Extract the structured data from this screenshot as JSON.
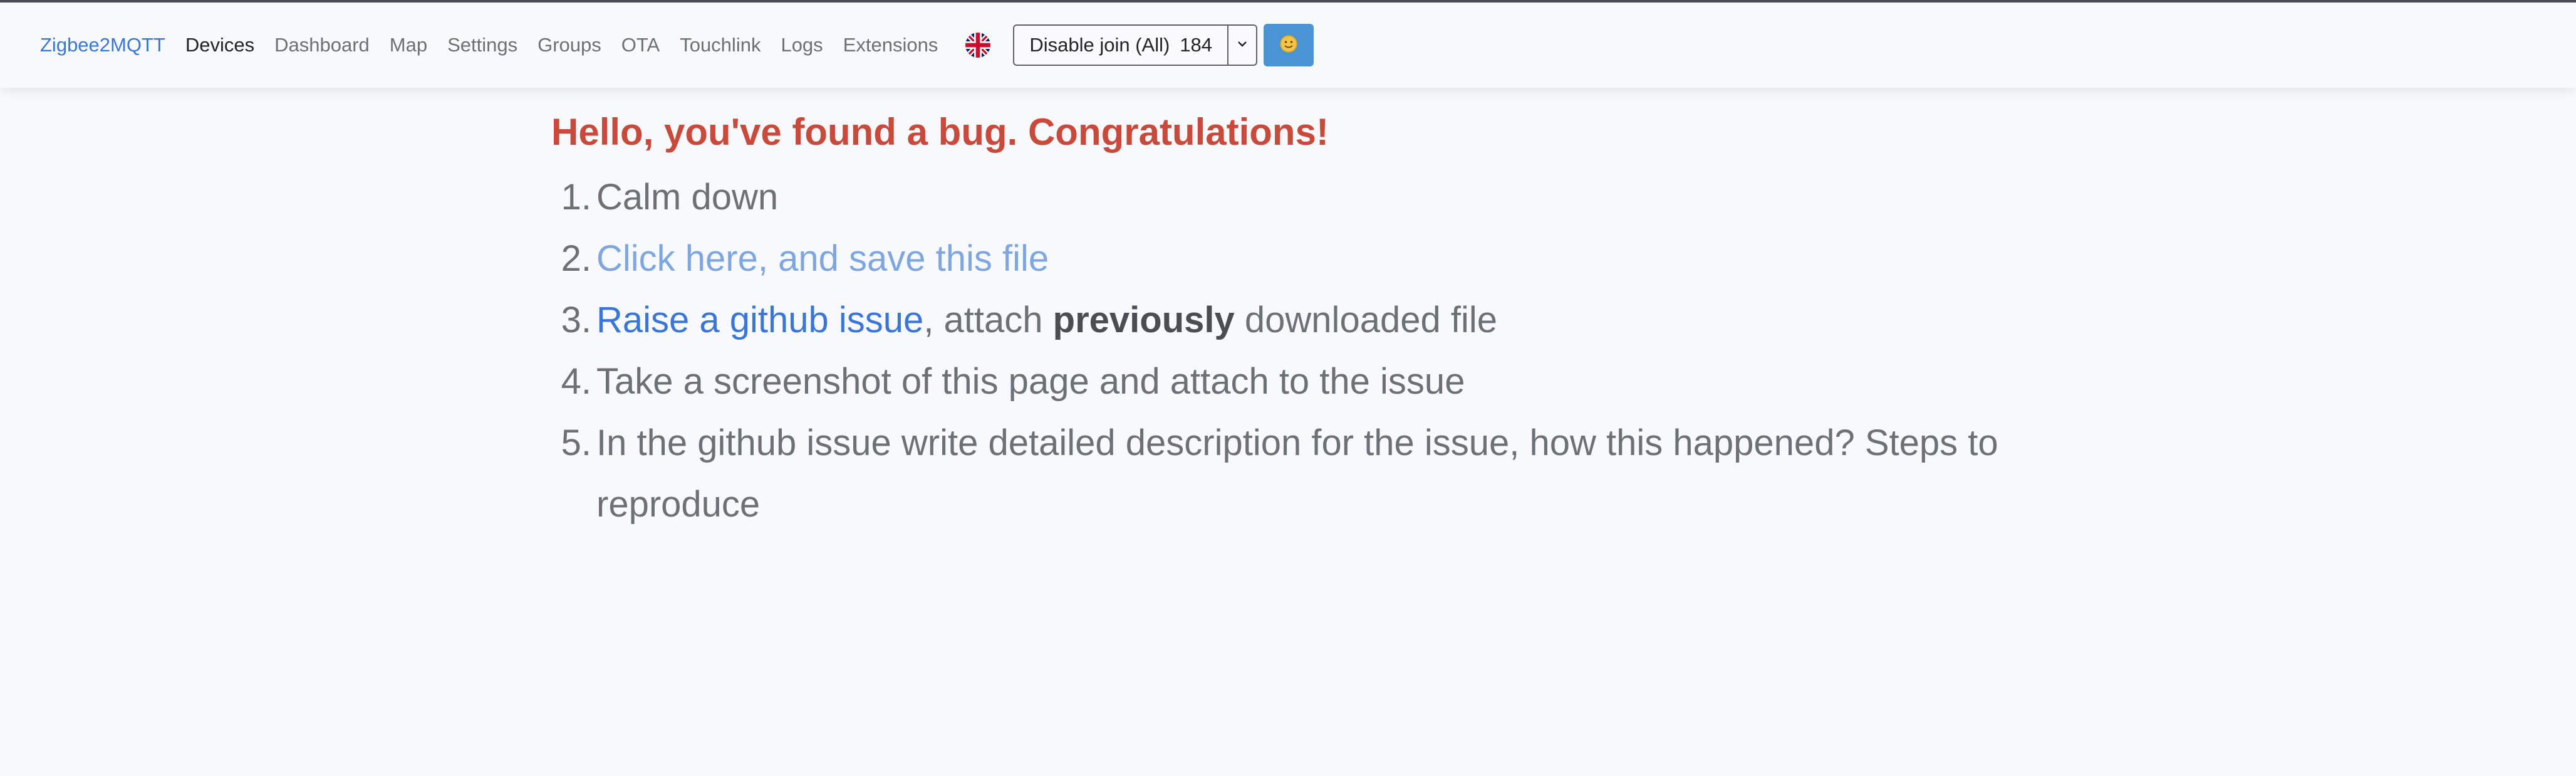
{
  "navbar": {
    "brand": "Zigbee2MQTT",
    "items": [
      {
        "label": "Devices",
        "active": true
      },
      {
        "label": "Dashboard"
      },
      {
        "label": "Map"
      },
      {
        "label": "Settings"
      },
      {
        "label": "Groups"
      },
      {
        "label": "OTA"
      },
      {
        "label": "Touchlink"
      },
      {
        "label": "Logs"
      },
      {
        "label": "Extensions"
      }
    ],
    "language_icon": "uk-flag-icon",
    "join_button": {
      "label": "Disable join (All)",
      "count": "184"
    },
    "dropdown_icon": "chevron-down-icon",
    "smiley_icon": "smiley-face-icon"
  },
  "error": {
    "title": "Hello, you've found a bug. Congratulations!",
    "steps": [
      {
        "number": "1.",
        "text": "Calm down"
      },
      {
        "number": "2.",
        "link": "Click here, and save this file"
      },
      {
        "number": "3.",
        "link": "Raise a github issue",
        "text_a": ", attach ",
        "bold": "previously",
        "text_b": " downloaded file"
      },
      {
        "number": "4.",
        "text": "Take a screenshot of this page and attach to the issue"
      },
      {
        "number": "5.",
        "text": "In the github issue write detailed description for the issue, how this happened? Steps to reproduce"
      }
    ]
  },
  "colors": {
    "brand": "#3a76d8",
    "title": "#c9493b",
    "link_visited": "#7ea6e0",
    "link": "#3a76d8",
    "text": "#6c7177",
    "button_accent": "#4a94d6"
  }
}
